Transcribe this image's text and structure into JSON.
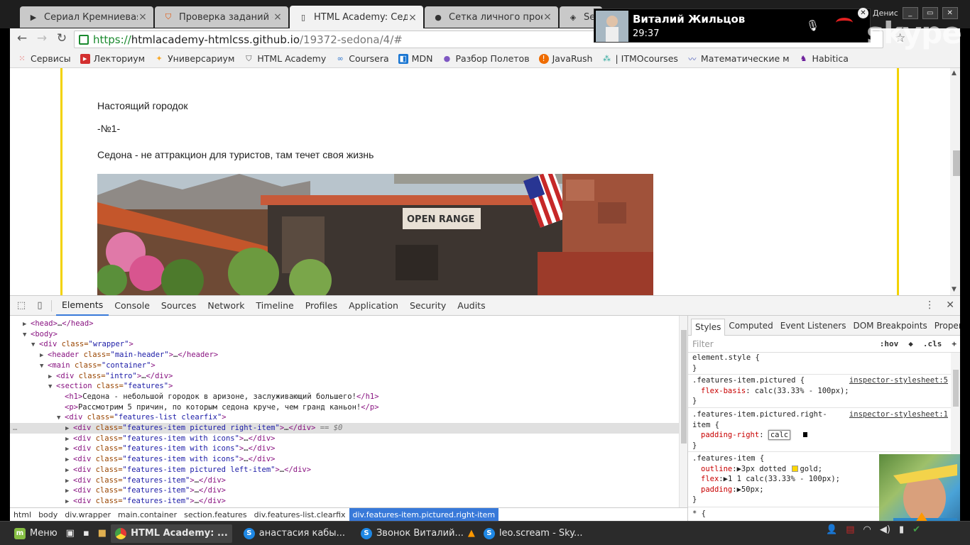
{
  "browser": {
    "tabs": [
      {
        "title": "Сериал Кремниевая д",
        "icon": "play-icon",
        "active": false
      },
      {
        "title": "Проверка заданий — ",
        "icon": "shield-icon",
        "active": false
      },
      {
        "title": "HTML Academy: Седон",
        "icon": "page-icon",
        "active": true
      },
      {
        "title": "Сетка личного проект",
        "icon": "github-icon",
        "active": false
      },
      {
        "title": "Sed",
        "icon": "codepen-icon",
        "active": false
      }
    ],
    "url": {
      "scheme": "https://",
      "host": "htmlacademy-htmlcss.github.io",
      "path": "/19372-sedona/4/#"
    },
    "bookmarks": [
      {
        "label": "Сервисы",
        "icon": "apps-grid-icon",
        "color": "#e53935"
      },
      {
        "label": "Лекториум",
        "icon": "video-icon",
        "color": "#d32f2f"
      },
      {
        "label": "Универсариум",
        "icon": "star-person-icon",
        "color": "#f9a825"
      },
      {
        "label": "HTML Academy",
        "icon": "shield-icon",
        "color": "#555555"
      },
      {
        "label": "Coursera",
        "icon": "infinity-icon",
        "color": "#2a73cc"
      },
      {
        "label": "MDN",
        "icon": "mdn-icon",
        "color": "#1976d2"
      },
      {
        "label": "Разбор Полетов",
        "icon": "mic-icon",
        "color": "#7e57c2"
      },
      {
        "label": "JavaRush",
        "icon": "javarush-icon",
        "color": "#ef6c00"
      },
      {
        "label": "| ITMOcourses",
        "icon": "itmo-icon",
        "color": "#26a69a"
      },
      {
        "label": "Математические м",
        "icon": "wave-icon",
        "color": "#3f51b5"
      },
      {
        "label": "Habitica",
        "icon": "habitica-icon",
        "color": "#6a1b9a"
      }
    ]
  },
  "page": {
    "subtitle": "Настоящий городок",
    "number": "-№1-",
    "text": "Седона - не аттракцион для туристов, там течет своя жизнь",
    "sign_text": "OPEN RANGE"
  },
  "devtools": {
    "tabs": [
      "Elements",
      "Console",
      "Sources",
      "Network",
      "Timeline",
      "Profiles",
      "Application",
      "Security",
      "Audits"
    ],
    "active_tab": "Elements",
    "dom": {
      "head": {
        "open": "<head>",
        "ellipsis": "…",
        "close": "</head>"
      },
      "body": "<body>",
      "wrapper": {
        "tag": "<div ",
        "attr": "class=",
        "val": "\"wrapper\"",
        "end": ">"
      },
      "header": {
        "tag": "<header ",
        "attr": "class=",
        "val": "\"main-header\"",
        "end": ">",
        "ellipsis": "…",
        "close": "</header>"
      },
      "main": {
        "tag": "<main ",
        "attr": "class=",
        "val": "\"container\"",
        "end": ">"
      },
      "intro": {
        "tag": "<div ",
        "attr": "class=",
        "val": "\"intro\"",
        "end": ">",
        "ellipsis": "…",
        "close": "</div>"
      },
      "section": {
        "tag": "<section ",
        "attr": "class=",
        "val": "\"features\"",
        "end": ">"
      },
      "h1": {
        "open": "<h1>",
        "text": "Седона - небольшой городок в аризоне, заслуживающий большего!",
        "close": "</h1>"
      },
      "p": {
        "open": "<p>",
        "text": "Рассмотрим 5 причин, по которым седона круче, чем гранд каньон!",
        "close": "</p>"
      },
      "list": {
        "tag": "<div ",
        "attr": "class=",
        "val": "\"features-list clearfix\"",
        "end": ">"
      },
      "items": [
        {
          "val": "\"features-item pictured right-item\"",
          "suffix": " == $0"
        },
        {
          "val": "\"features-item with icons\"",
          "suffix": ""
        },
        {
          "val": "\"features-item with icons\"",
          "suffix": ""
        },
        {
          "val": "\"features-item with icons\"",
          "suffix": ""
        },
        {
          "val": "\"features-item  pictured left-item\"",
          "suffix": ""
        },
        {
          "val": "\"features-item\"",
          "suffix": ""
        },
        {
          "val": "\"features-item\"",
          "suffix": ""
        },
        {
          "val": "\"features-item\"",
          "suffix": ""
        }
      ],
      "item_tag": "<div ",
      "item_attr": "class=",
      "item_end": ">",
      "item_ellipsis": "…",
      "item_close": "</div>",
      "dots": "…"
    },
    "breadcrumbs": [
      "html",
      "body",
      "div.wrapper",
      "main.container",
      "section.features",
      "div.features-list.clearfix",
      "div.features-item.pictured.right-item"
    ],
    "styles_tabs": [
      "Styles",
      "Computed",
      "Event Listeners",
      "DOM Breakpoints",
      "Properties"
    ],
    "filter_placeholder": "Filter",
    "filter_buttons": [
      ":hov",
      ".cls",
      "+"
    ],
    "rules": {
      "element_style": {
        "selector": "element.style {",
        "close": "}"
      },
      "pictured": {
        "selector": ".features-item.pictured {",
        "source": "inspector-stylesheet:5",
        "prop": "flex-basis",
        "value": "calc(33.33% - 100px);",
        "close": "}"
      },
      "pictured_right": {
        "selector1": ".features-item.pictured.right-",
        "selector2": "item {",
        "source": "inspector-stylesheet:1",
        "prop": "padding-right",
        "value": "calc",
        "close": "}"
      },
      "features_item": {
        "selector": ".features-item {",
        "outline_prop": "outline",
        "outline_val1": "3px dotted ",
        "outline_val2": "gold;",
        "flex_prop": "flex",
        "flex_val": "1 1 calc(33.33% - 100px);",
        "padding_prop": "padding",
        "padding_val": "50px;",
        "close": "}"
      },
      "universal": {
        "selector": "* {"
      }
    }
  },
  "skype": {
    "caller": "Виталий Жильцов",
    "duration": "29:37",
    "brand": "skype",
    "user": "Денис"
  },
  "taskbar": {
    "menu": "Меню",
    "items": [
      {
        "label": "HTML Academy: ...",
        "icon": "chrome-icon",
        "active": true
      },
      {
        "label": "анастасия кабы...",
        "icon": "skype-icon",
        "active": false
      },
      {
        "label": "Звонок Виталий...",
        "icon": "skype-icon",
        "active": false
      },
      {
        "label": "leo.scream - Sky...",
        "icon": "skype-icon",
        "active": false
      }
    ]
  },
  "colors": {
    "accent_yellow": "#f2d200",
    "devtools_blue": "#3879d9",
    "tag_purple": "#881280",
    "attr_brown": "#994500",
    "value_blue": "#1a1aa6",
    "css_prop_red": "#c80000"
  }
}
